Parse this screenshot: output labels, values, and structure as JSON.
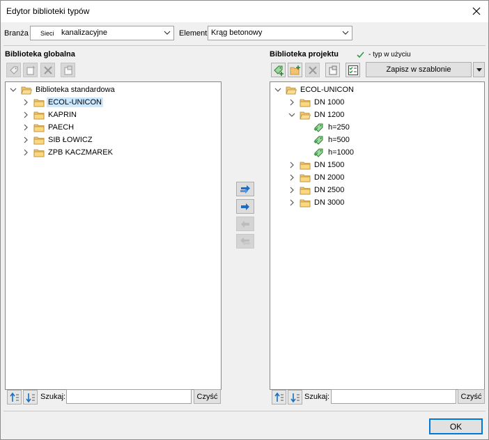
{
  "window": {
    "title": "Edytor biblioteki typów"
  },
  "filters": {
    "branza_label": "Branża",
    "branza_prefix": "Sieci",
    "branza_value": "kanalizacyjne",
    "element_label": "Element",
    "element_value": "Krąg betonowy"
  },
  "global": {
    "title": "Biblioteka globalna",
    "search_label": "Szukaj:",
    "search_value": "",
    "clear_label": "Czyść",
    "tree": {
      "root": "Biblioteka standardowa",
      "children": [
        "ECOL-UNICON",
        "KAPRIN",
        "PAECH",
        "SIB ŁOWICZ",
        "ZPB KACZMAREK"
      ]
    }
  },
  "project": {
    "title": "Biblioteka projektu",
    "legend": "- typ w użyciu",
    "save_template_label": "Zapisz w szablonie",
    "search_label": "Szukaj:",
    "search_value": "",
    "clear_label": "Czyść",
    "tree": {
      "root": "ECOL-UNICON",
      "nodes": [
        "DN 1000",
        "DN 1200",
        "DN 1500",
        "DN 2000",
        "DN 2500",
        "DN 3000"
      ],
      "dn1200_children": [
        "h=250",
        "h=500",
        "h=1000"
      ]
    }
  },
  "footer": {
    "ok_label": "OK"
  },
  "colors": {
    "accent": "#0078d7",
    "selection": "#cce8ff",
    "folder": "#f2c46d",
    "in_use_check": "#2e9e3c"
  }
}
